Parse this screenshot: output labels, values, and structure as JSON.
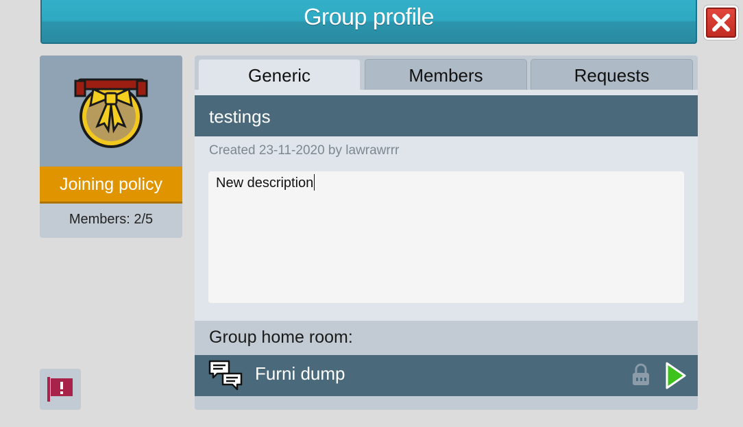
{
  "window": {
    "title": "Group profile"
  },
  "left": {
    "join_button": "Joining policy",
    "members_text": "Members: 2/5"
  },
  "tabs": [
    {
      "label": "Generic",
      "active": true
    },
    {
      "label": "Members",
      "active": false
    },
    {
      "label": "Requests",
      "active": false
    }
  ],
  "group": {
    "name": "testings",
    "created": "Created 23-11-2020 by lawrawrrr",
    "description": "New description"
  },
  "home_room": {
    "label": "Group home room:",
    "room_name": "Furni dump"
  },
  "icons": {
    "close": "close-icon",
    "badge": "group-badge-icon",
    "report": "report-flag-icon",
    "room": "chat-bubbles-icon",
    "lock": "lock-icon",
    "go": "play-arrow-icon"
  },
  "colors": {
    "title_bar": "#2fa9c2",
    "join_button": "#e09400",
    "header_bar": "#4a6a7c",
    "close": "#d0342b",
    "go_arrow": "#3ec21e"
  }
}
